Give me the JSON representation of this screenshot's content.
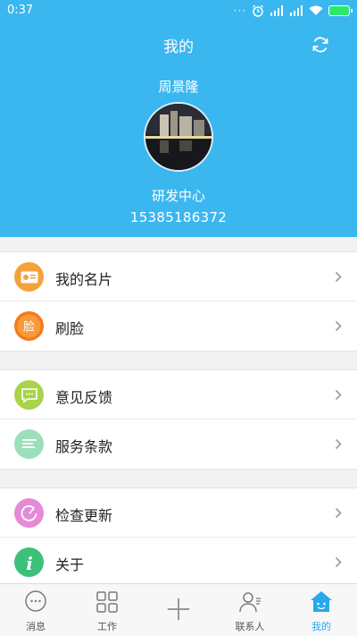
{
  "status_bar": {
    "time": "0:37"
  },
  "header": {
    "title": "我的",
    "name": "周景隆",
    "department": "研发中心",
    "phone": "15385186372"
  },
  "menu_groups": [
    [
      {
        "label": "我的名片",
        "icon": "business-card-icon",
        "color": "#f4a23c"
      },
      {
        "label": "刷脸",
        "icon": "face-icon",
        "color": "#f47a1a"
      }
    ],
    [
      {
        "label": "意见反馈",
        "icon": "feedback-icon",
        "color": "#a8d34a"
      },
      {
        "label": "服务条款",
        "icon": "terms-icon",
        "color": "#9be0b8"
      }
    ],
    [
      {
        "label": "检查更新",
        "icon": "update-icon",
        "color": "#e58ad8"
      },
      {
        "label": "关于",
        "icon": "info-icon",
        "color": "#3cc07a"
      }
    ]
  ],
  "tabs": [
    {
      "label": "消息",
      "icon": "message-icon"
    },
    {
      "label": "工作",
      "icon": "grid-icon"
    },
    {
      "label": "",
      "icon": "plus-icon"
    },
    {
      "label": "联系人",
      "icon": "contacts-icon"
    },
    {
      "label": "我的",
      "icon": "home-icon",
      "active": true
    }
  ],
  "colors": {
    "header": "#3bb7f0",
    "active_tab": "#2aa9ea"
  }
}
